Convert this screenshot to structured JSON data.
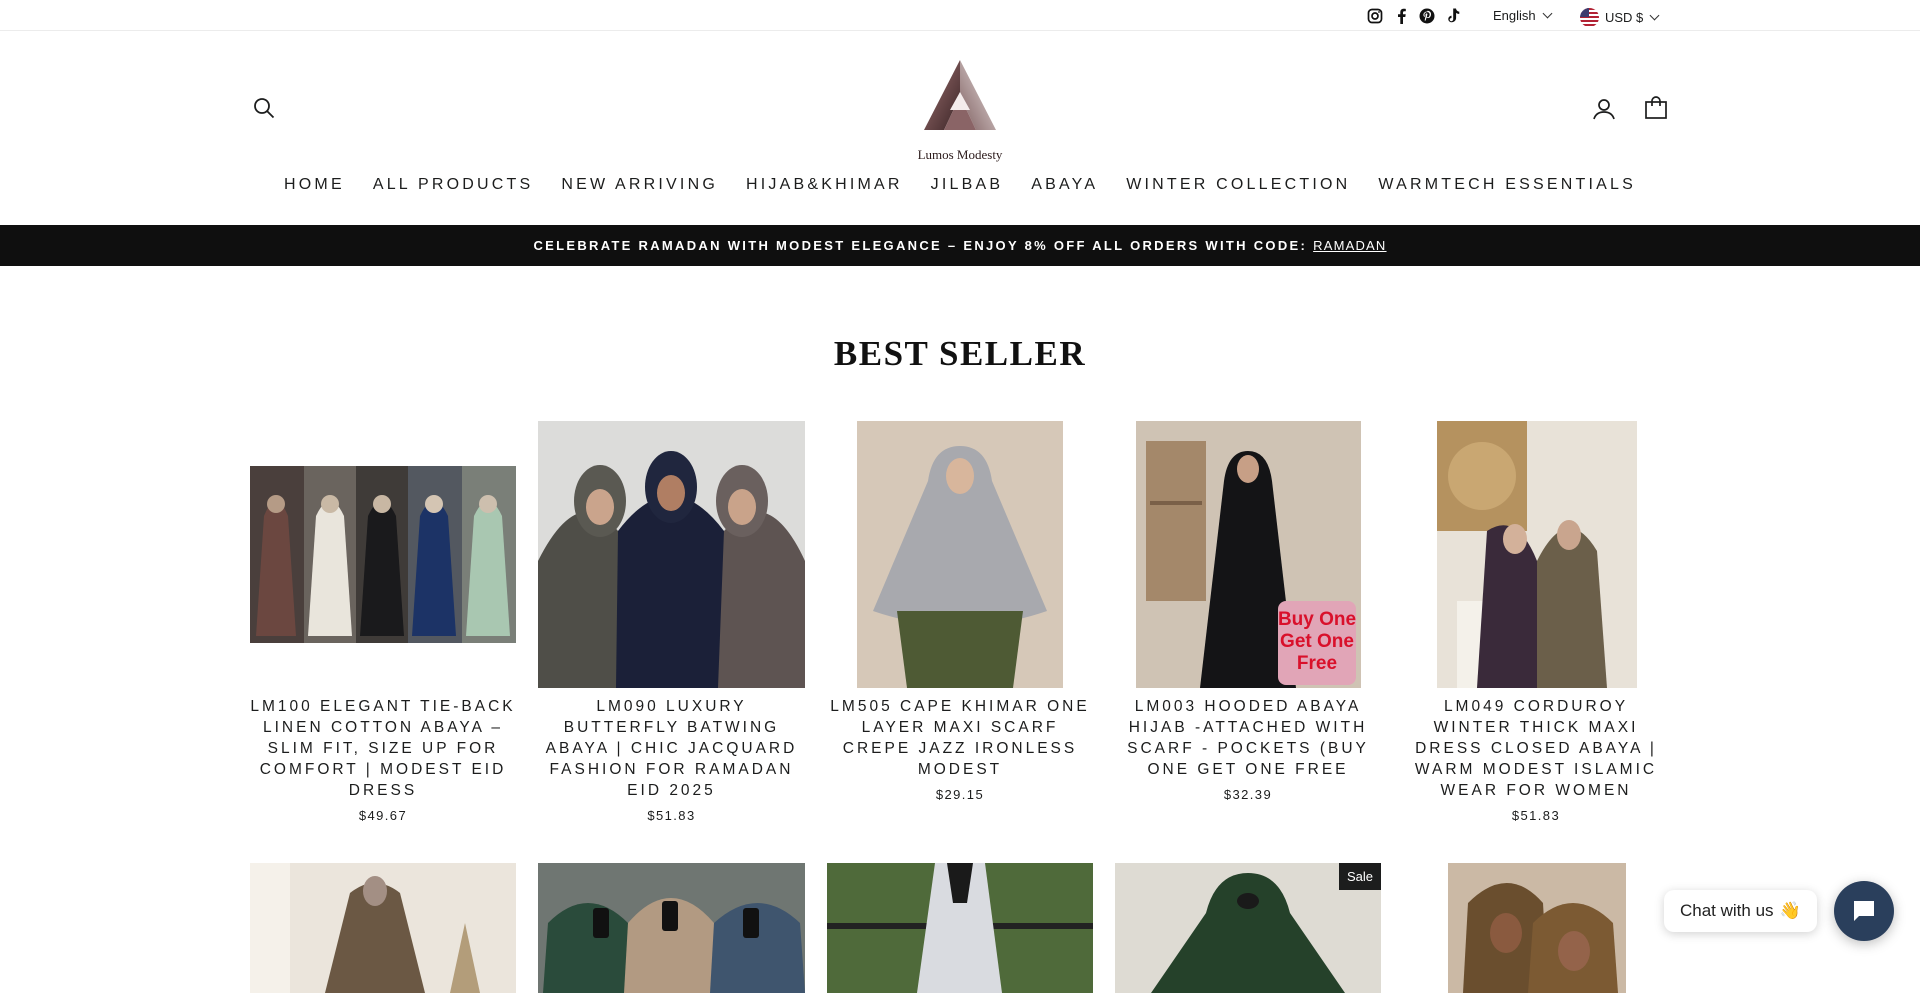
{
  "utility": {
    "socials": [
      "instagram-icon",
      "facebook-icon",
      "pinterest-icon",
      "tiktok-icon"
    ],
    "language": "English",
    "currency": "USD $"
  },
  "header": {
    "logo_text": "Lumos Modesty"
  },
  "nav": [
    "HOME",
    "ALL PRODUCTS",
    "NEW ARRIVING",
    "HIJAB&KHIMAR",
    "JILBAB",
    "ABAYA",
    "WINTER COLLECTION",
    "WARMTECH ESSENTIALS"
  ],
  "announcement": {
    "text": "CELEBRATE RAMADAN WITH MODEST ELEGANCE – ENJOY 8% OFF ALL ORDERS WITH CODE:",
    "code": "RAMADAN"
  },
  "section": {
    "title": "BEST SELLER"
  },
  "products": [
    {
      "title": "LM100 Elegant Tie-Back Linen Cotton Abaya – Slim Fit, Size Up for Comfort | Modest Eid Dress",
      "price": "$49.67"
    },
    {
      "title": "LM090 Luxury Butterfly Batwing Abaya | Chic Jacquard Fashion for Ramadan Eid 2025",
      "price": "$51.83"
    },
    {
      "title": "LM505 Cape Khimar One Layer Maxi Scarf Crepe Jazz Ironless Modest",
      "price": "$29.15"
    },
    {
      "title": "LM003 Hooded Abaya Hijab -Attached with Scarf - Pockets (Buy One Get One Free",
      "price": "$32.39",
      "promo": "Buy One Get One Free"
    },
    {
      "title": "LM049 Corduroy Winter Thick Maxi Dress Closed Abaya | Warm Modest Islamic Wear for Women",
      "price": "$51.83"
    }
  ],
  "row2": {
    "sale_badge": "Sale"
  },
  "chat": {
    "label": "Chat with us",
    "emoji": "👋"
  },
  "colors": {
    "announcement_bg": "#0f0f0f",
    "chat_button": "#2a3f5c",
    "text": "#1c1d1d"
  }
}
